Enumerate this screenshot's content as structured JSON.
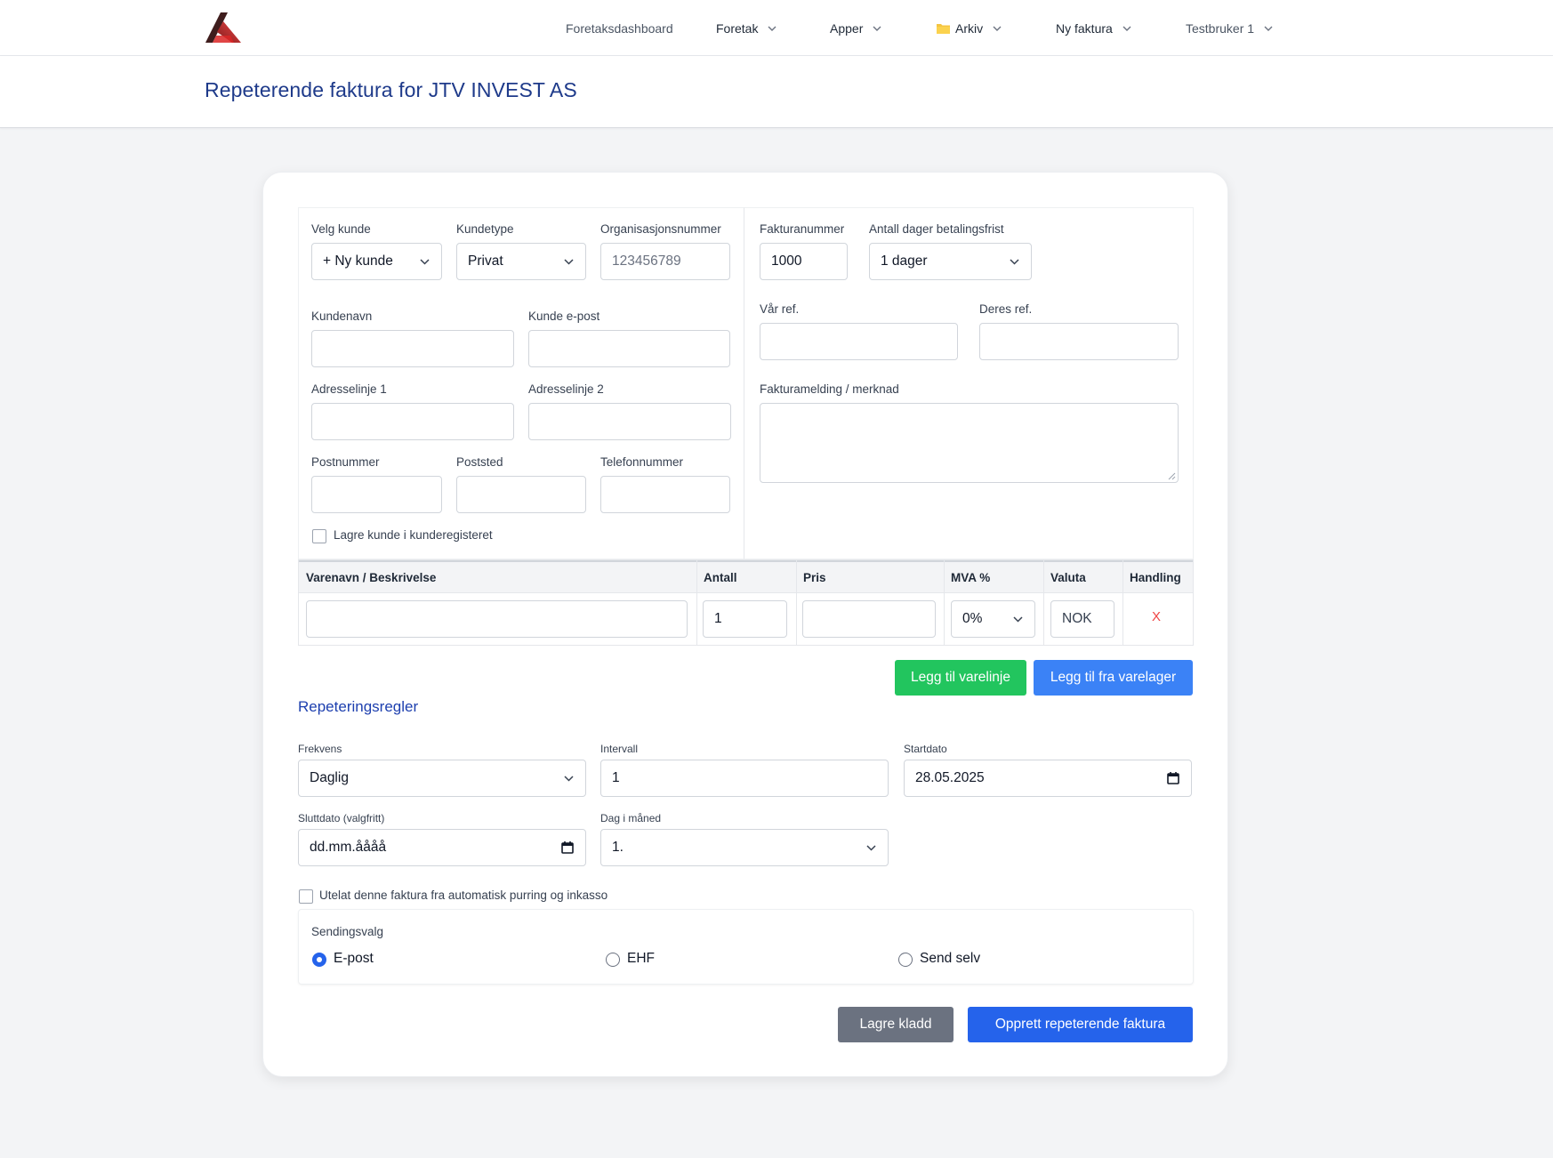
{
  "nav": {
    "dashboard": "Foretaksdashboard",
    "foretak": "Foretak",
    "apper": "Apper",
    "arkiv": "Arkiv",
    "ny_faktura": "Ny faktura",
    "user": "Testbruker 1"
  },
  "page": {
    "title": "Repeterende faktura for JTV INVEST AS"
  },
  "customer": {
    "velg_kunde_label": "Velg kunde",
    "velg_kunde_value": "+ Ny kunde",
    "kundetype_label": "Kundetype",
    "kundetype_value": "Privat",
    "orgnr_label": "Organisasjonsnummer",
    "orgnr_placeholder": "123456789",
    "kundenavn_label": "Kundenavn",
    "kunde_epost_label": "Kunde e-post",
    "adresse1_label": "Adresselinje 1",
    "adresse2_label": "Adresselinje 2",
    "postnummer_label": "Postnummer",
    "poststed_label": "Poststed",
    "telefon_label": "Telefonnummer",
    "lagre_kunde_label": "Lagre kunde i kunderegisteret"
  },
  "invoice": {
    "fakturanummer_label": "Fakturanummer",
    "fakturanummer_value": "1000",
    "betalingsfrist_label": "Antall dager betalingsfrist",
    "betalingsfrist_value": "1 dager",
    "var_ref_label": "Vår ref.",
    "deres_ref_label": "Deres ref.",
    "melding_label": "Fakturamelding / merknad"
  },
  "lines": {
    "headers": {
      "desc": "Varenavn / Beskrivelse",
      "antall": "Antall",
      "pris": "Pris",
      "mva": "MVA %",
      "valuta": "Valuta",
      "handling": "Handling"
    },
    "row": {
      "antall": "1",
      "mva": "0%",
      "valuta": "NOK",
      "delete": "X"
    },
    "add_line_button": "Legg til varelinje",
    "add_from_stock_button": "Legg til fra varelager"
  },
  "repeat": {
    "title": "Repeteringsregler",
    "frekvens_label": "Frekvens",
    "frekvens_value": "Daglig",
    "intervall_label": "Intervall",
    "intervall_value": "1",
    "startdato_label": "Startdato",
    "startdato_value": "28.05.2025",
    "sluttdato_label": "Sluttdato (valgfritt)",
    "sluttdato_placeholder": "dd.mm.åååå",
    "dag_label": "Dag i måned",
    "dag_value": "1.",
    "utelat_label": "Utelat denne faktura fra automatisk purring og inkasso"
  },
  "sending": {
    "label": "Sendingsvalg",
    "options": [
      "E-post",
      "EHF",
      "Send selv"
    ],
    "selected": "E-post"
  },
  "actions": {
    "save_draft": "Lagre kladd",
    "create": "Opprett repeterende faktura"
  },
  "colors": {
    "accent_blue": "#2563eb",
    "title_blue": "#1e3a8a",
    "green": "#22c55e",
    "gray_button": "#6b7280",
    "delete_red": "#ef4444"
  }
}
